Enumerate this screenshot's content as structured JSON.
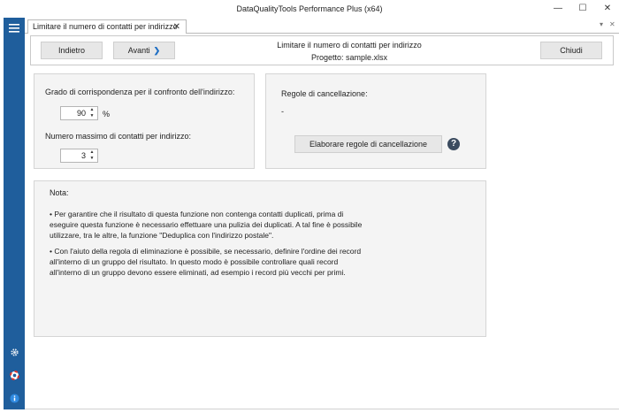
{
  "window": {
    "title": "DataQualityTools Performance Plus (x64)",
    "minimize": "—",
    "maximize": "☐",
    "close": "✕"
  },
  "tab": {
    "label": "Limitare il numero di contatti per indirizzo",
    "close": "✕",
    "overflow": "▾",
    "close_all": "✕"
  },
  "toolbar": {
    "back_label": "Indietro",
    "next_label": "Avanti",
    "next_chevron": "❯",
    "title": "Limitare il numero di contatti per indirizzo",
    "project": "Progetto: sample.xlsx",
    "close_label": "Chiudi"
  },
  "settings": {
    "match_label": "Grado di corrispondenza per il confronto dell'indirizzo:",
    "match_value": "90",
    "match_unit": "%",
    "max_label": "Numero massimo di contatti per indirizzo:",
    "max_value": "3",
    "spin_up": "▲",
    "spin_down": "▼"
  },
  "rules": {
    "label": "Regole di cancellazione:",
    "value": "-",
    "button": "Elaborare regole di cancellazione",
    "help": "?"
  },
  "note": {
    "title": "Nota:",
    "p1_lines": [
      "• Per garantire che il risultato di questa funzione non contenga contatti duplicati, prima di",
      "eseguire questa funzione è necessario effettuare una pulizia dei duplicati. A tal fine è possibile",
      "utilizzare, tra le altre, la funzione \"Deduplica con l'indirizzo postale\"."
    ],
    "p2_lines": [
      "• Con l'aiuto della regola di eliminazione è possibile, se necessario, definire l'ordine dei record",
      "all'interno di un gruppo del risultato. In questo modo è possibile controllare quali record",
      "all'interno di un gruppo devono essere eliminati, ad esempio i record più vecchi per primi."
    ]
  },
  "colors": {
    "sidebar": "#1f5e9c",
    "panel_bg": "#f4f4f4",
    "button_bg": "#e7e7e7",
    "accent": "#1f6fc4"
  }
}
